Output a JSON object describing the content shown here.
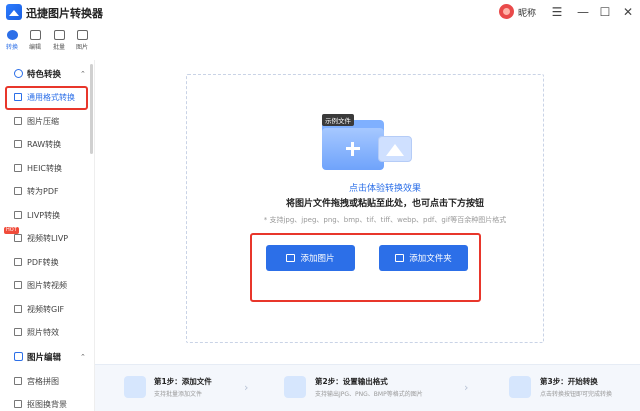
{
  "app": {
    "title": "迅捷图片转换器",
    "user_name": "昵称"
  },
  "window_controls": {
    "menu": "☰",
    "minimize": "—",
    "maximize": "☐",
    "close": "✕"
  },
  "tabs": [
    {
      "label": "转换",
      "icon": "convert-icon",
      "active": true
    },
    {
      "label": "编辑",
      "icon": "edit-icon",
      "active": false
    },
    {
      "label": "批量",
      "icon": "batch-icon",
      "active": false
    },
    {
      "label": "图片",
      "icon": "image-icon",
      "active": false
    }
  ],
  "sidebar": {
    "section_convert": "特色转换",
    "section_edit": "图片编辑",
    "hot_badge": "HOT",
    "items": [
      {
        "label": "通用格式转换",
        "active": true
      },
      {
        "label": "图片压缩"
      },
      {
        "label": "RAW转换"
      },
      {
        "label": "HEIC转换"
      },
      {
        "label": "转为PDF"
      },
      {
        "label": "LIVP转换"
      },
      {
        "label": "视频转LIVP"
      },
      {
        "label": "PDF转换"
      },
      {
        "label": "图片转视频"
      },
      {
        "label": "视频转GIF"
      },
      {
        "label": "照片特效"
      }
    ],
    "edit_items": [
      {
        "label": "宫格拼图"
      },
      {
        "label": "抠图换背景"
      }
    ]
  },
  "drop": {
    "sample_tag": "示例文件",
    "sample_link": "点击体验转换效果",
    "hint": "将图片文件拖拽或粘贴至此处，也可点击下方按钮",
    "support": "* 支持jpg、jpeg、png、bmp、tif、tiff、webp、pdf、gif等百余种图片格式"
  },
  "buttons": {
    "add_image": "添加图片",
    "add_folder": "添加文件夹"
  },
  "steps": [
    {
      "title": "第1步：添加文件",
      "desc": "支持批量添加文件"
    },
    {
      "title": "第2步：设置输出格式",
      "desc": "支持输出JPG、PNG、BMP等格式的图片"
    },
    {
      "title": "第3步：开始转换",
      "desc": "点击转换按钮即可完成转换"
    }
  ],
  "colors": {
    "accent": "#2c6fe8",
    "highlight_frame": "#e8362b"
  }
}
